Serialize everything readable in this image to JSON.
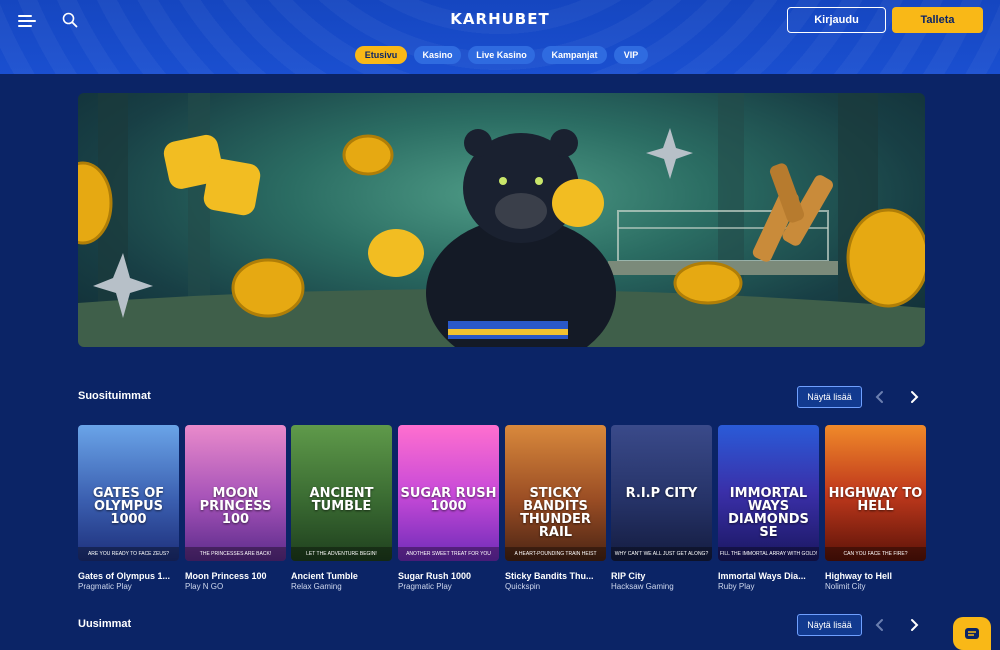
{
  "header": {
    "logo": "KARHUBET",
    "login_label": "Kirjaudu",
    "deposit_label": "Talleta",
    "tabs": [
      {
        "label": "Etusivu",
        "active": true
      },
      {
        "label": "Kasino",
        "active": false
      },
      {
        "label": "Live Kasino",
        "active": false
      },
      {
        "label": "Kampanjat",
        "active": false
      },
      {
        "label": "VIP",
        "active": false
      }
    ]
  },
  "sections": {
    "popular": {
      "title": "Suosituimmat",
      "more_label": "Näytä lisää"
    },
    "newest": {
      "title": "Uusimmat",
      "more_label": "Näytä lisää"
    }
  },
  "games": [
    {
      "name": "Gates of Olympus 1...",
      "provider": "Pragmatic Play",
      "art_title": "GATES OF OLYMPUS 1000",
      "tagline": "ARE YOU READY TO FACE ZEUS?"
    },
    {
      "name": "Moon Princess 100",
      "provider": "Play N GO",
      "art_title": "MOON PRINCESS 100",
      "tagline": "THE PRINCESSES ARE BACK!"
    },
    {
      "name": "Ancient Tumble",
      "provider": "Relax Gaming",
      "art_title": "ANCIENT TUMBLE",
      "tagline": "LET THE ADVENTURE BEGIN!"
    },
    {
      "name": "Sugar Rush 1000",
      "provider": "Pragmatic Play",
      "art_title": "SUGAR RUSH 1000",
      "tagline": "ANOTHER SWEET TREAT FOR YOU"
    },
    {
      "name": "Sticky Bandits Thu...",
      "provider": "Quickspin",
      "art_title": "STICKY BANDITS THUNDER RAIL",
      "tagline": "A HEART-POUNDING TRAIN HEIST AWAITS"
    },
    {
      "name": "RIP City",
      "provider": "Hacksaw Gaming",
      "art_title": "R.I.P CITY",
      "tagline": "WHY CAN'T WE ALL JUST GET ALONG?"
    },
    {
      "name": "Immortal Ways Dia...",
      "provider": "Ruby Play",
      "art_title": "IMMORTAL WAYS DIAMONDS SE",
      "tagline": "FILL THE IMMORTAL ARRAY WITH GOLD!"
    },
    {
      "name": "Highway to Hell",
      "provider": "Nolimit City",
      "art_title": "HIGHWAY TO HELL",
      "tagline": "CAN YOU FACE THE FIRE?"
    }
  ],
  "colors": {
    "page_bg": "#0b2466",
    "header_bg": "#1a4fd0",
    "accent": "#f9b817",
    "tab_bg": "#2f6be0"
  },
  "icons": [
    "menu-icon",
    "search-icon",
    "chevron-left-icon",
    "chevron-right-icon",
    "chat-icon"
  ]
}
